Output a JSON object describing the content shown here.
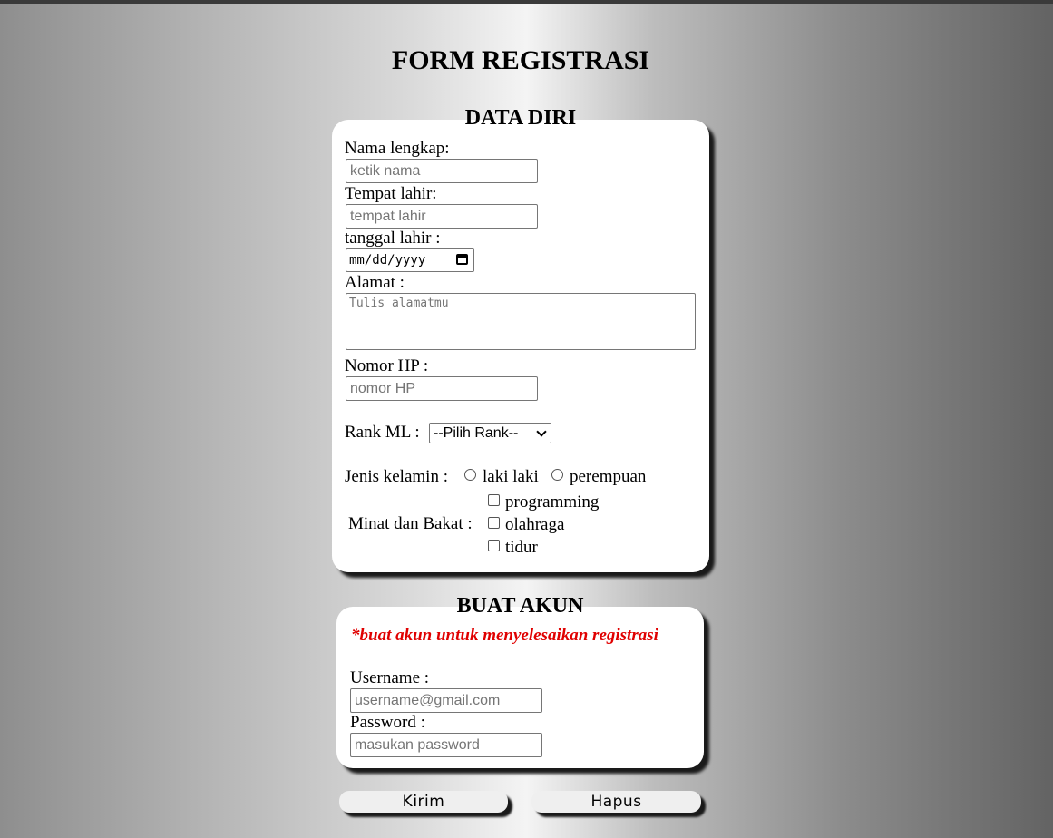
{
  "page_title": "FORM REGISTRASI",
  "data_diri": {
    "title": "DATA DIRI",
    "nama_label": "Nama lengkap:",
    "nama_placeholder": "ketik nama",
    "tempat_label": "Tempat lahir:",
    "tempat_placeholder": "tempat lahir",
    "tanggal_label": "tanggal lahir :",
    "tanggal_value": "mm/dd/yyyy",
    "alamat_label": "Alamat :",
    "alamat_placeholder": "Tulis alamatmu",
    "hp_label": "Nomor HP :",
    "hp_placeholder": "nomor HP",
    "rank_label": "Rank ML :",
    "rank_selected": "--Pilih Rank--",
    "gender_label": "Jenis kelamin :",
    "gender_options": [
      "laki laki",
      "perempuan"
    ],
    "minat_label": "Minat dan Bakat :",
    "minat_options": [
      "programming",
      "olahraga",
      "tidur"
    ]
  },
  "buat_akun": {
    "title": "BUAT AKUN",
    "note": "*buat akun untuk menyelesaikan registrasi",
    "username_label": "Username :",
    "username_placeholder": "username@gmail.com",
    "password_label": "Password :",
    "password_placeholder": "masukan password"
  },
  "buttons": {
    "submit": "Kirim",
    "reset": "Hapus"
  },
  "colors": {
    "note_red": "#e00000",
    "panel_bg": "#ffffff",
    "shadow": "#1a1a1a"
  }
}
